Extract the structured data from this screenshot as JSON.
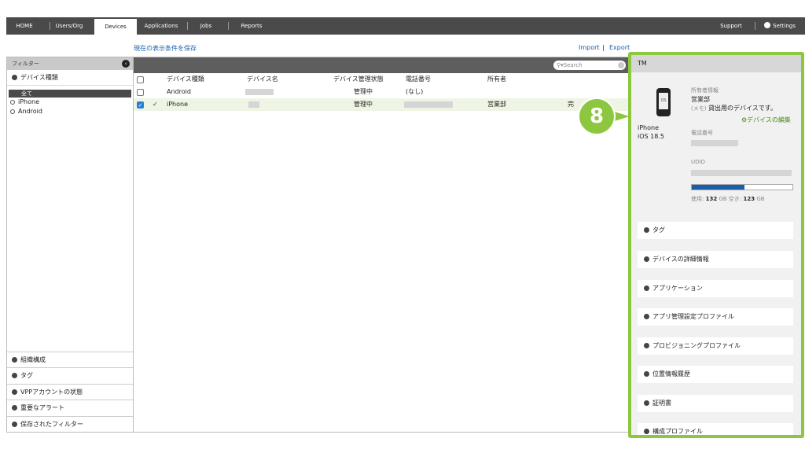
{
  "nav": {
    "tabs": [
      {
        "label": "HOME"
      },
      {
        "label": "Users/Org"
      },
      {
        "label": "Devices"
      },
      {
        "label": "Applications"
      },
      {
        "label": "Jobs"
      },
      {
        "label": "Reports"
      }
    ],
    "support": "Support",
    "settings": "Settings"
  },
  "toolbar": {
    "save_filter": "現在の表示条件を保存",
    "import": "Import",
    "sep": "|",
    "export": "Export"
  },
  "filter": {
    "title": "フィルター",
    "device_type": {
      "title": "デバイス種類",
      "options": [
        {
          "label": "全て",
          "selected": true
        },
        {
          "label": "iPhone"
        },
        {
          "label": "Android"
        }
      ]
    },
    "sections": [
      "組織構成",
      "タグ",
      "VPPアカウントの状態",
      "重要なアラート",
      "保存されたフィルター"
    ]
  },
  "table": {
    "search_placeholder": "Search",
    "columns": [
      "デバイス種類",
      "デバイス名",
      "デバイス管理状態",
      "電話番号",
      "所有者"
    ],
    "rows": [
      {
        "type": "Android",
        "status": "管理中",
        "phone": "(なし)",
        "owner": "",
        "extra": ""
      },
      {
        "type": "iPhone",
        "status": "管理中",
        "phone": "",
        "owner": "営業部",
        "extra": "完"
      }
    ]
  },
  "detail": {
    "header": "TM",
    "device_model": "iPhone",
    "os_version": "iOS 18.5",
    "phone_screen": "OS",
    "owner_info_label": "所有者情報",
    "owner_dept": "営業部",
    "memo_label": "(メモ)",
    "memo_text": "貸出用のデバイスです。",
    "edit_link": "デバイスの編集",
    "phone_label": "電話番号",
    "udid_label": "UDID",
    "storage": {
      "used_label": "使用:",
      "used": "132",
      "free_label": "空き:",
      "free": "123",
      "unit": "GB",
      "fill_fraction": 0.52
    },
    "accordions": [
      "タグ",
      "デバイスの詳細情報",
      "アプリケーション",
      "アプリ管理設定プロファイル",
      "プロビジョニングプロファイル",
      "位置情報履歴",
      "証明書",
      "構成プロファイル"
    ]
  },
  "step_badge": "8",
  "colors": {
    "accent_green": "#8dc63f",
    "nav_bg": "#4a4a4a",
    "link_blue": "#1a5fa8",
    "check_blue": "#2d7dd2"
  }
}
